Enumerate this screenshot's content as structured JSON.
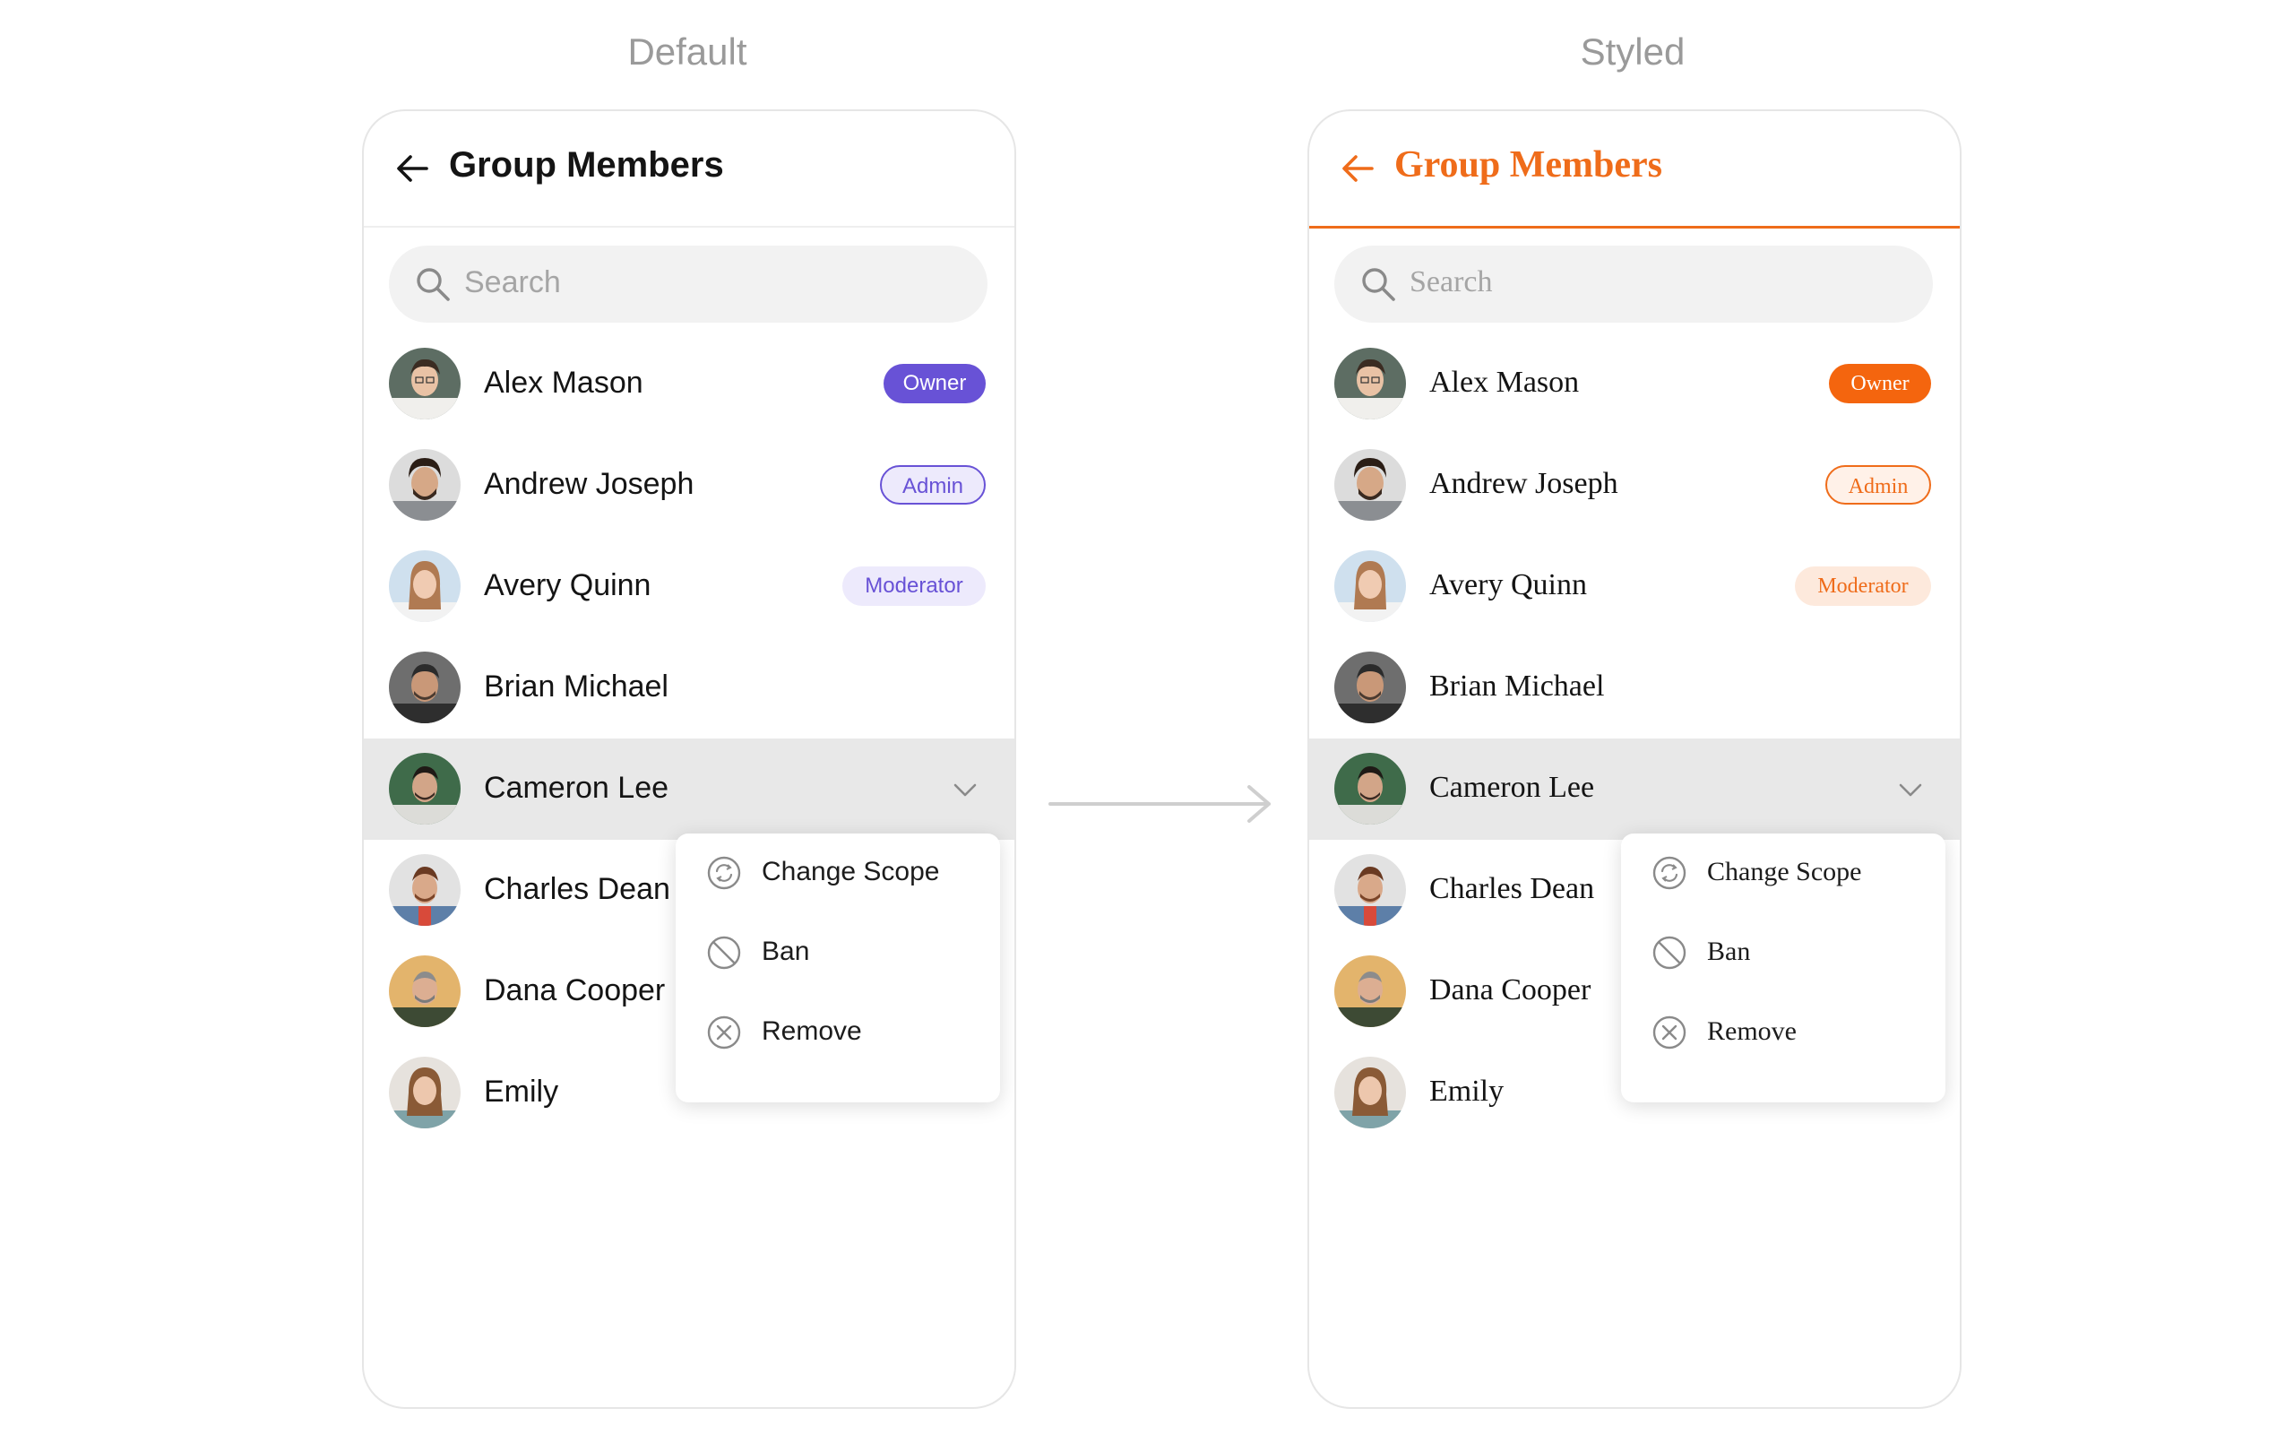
{
  "columns": {
    "default_label": "Default",
    "styled_label": "Styled"
  },
  "panel": {
    "title": "Group Members",
    "search_placeholder": "Search",
    "members": [
      {
        "name": "Alex Mason",
        "role": "Owner"
      },
      {
        "name": "Andrew Joseph",
        "role": "Admin"
      },
      {
        "name": "Avery Quinn",
        "role": "Moderator"
      },
      {
        "name": "Brian Michael",
        "role": ""
      },
      {
        "name": "Cameron Lee",
        "role": ""
      },
      {
        "name": "Charles Dean",
        "role": ""
      },
      {
        "name": "Dana Cooper",
        "role": ""
      },
      {
        "name": "Emily",
        "role": ""
      }
    ],
    "menu": {
      "change_scope": "Change Scope",
      "ban": "Ban",
      "remove": "Remove"
    }
  },
  "colors": {
    "default_accent": "#6852d6",
    "styled_accent": "#ef6c1a",
    "highlight_row": "#e8e8e8"
  },
  "icons": {
    "back": "arrow-left-icon",
    "search": "search-icon",
    "expand": "chevron-down-icon",
    "change_scope": "refresh-circle-icon",
    "ban": "ban-icon",
    "remove": "close-circle-icon"
  }
}
